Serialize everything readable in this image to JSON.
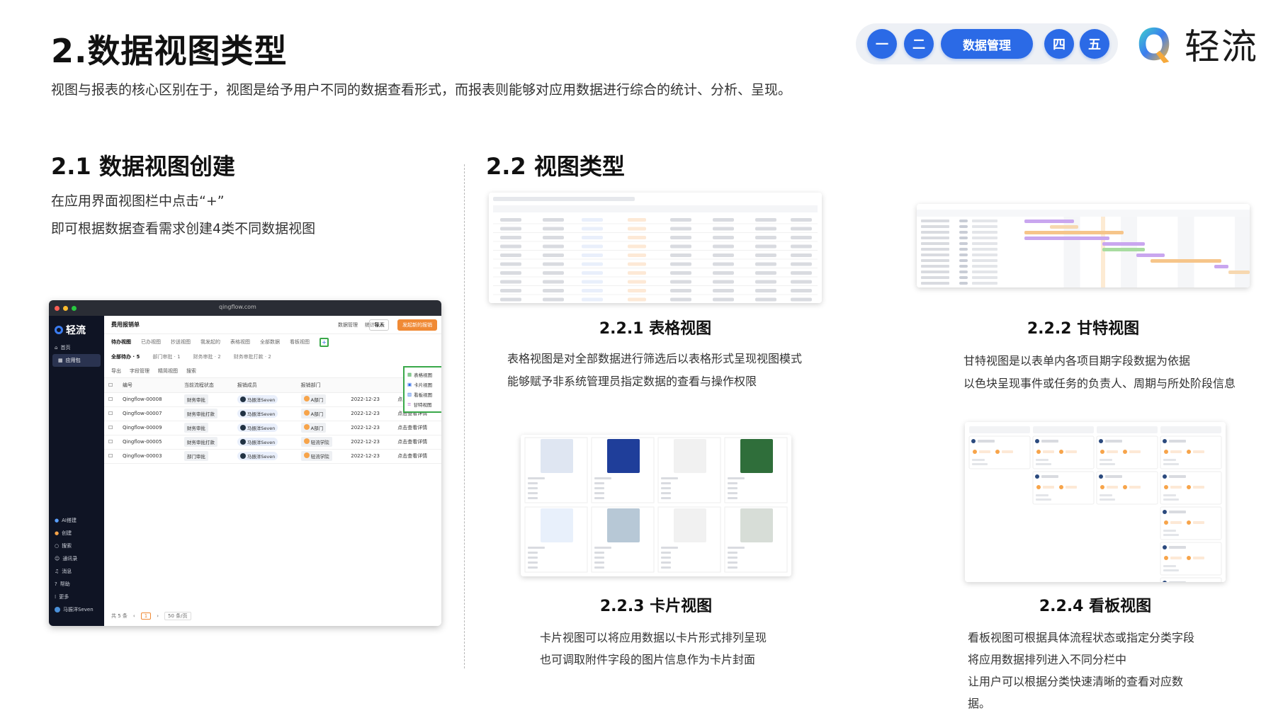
{
  "header": {
    "title": "2.数据视图类型",
    "subtitle": "视图与报表的核心区别在于，视图是给予用户不同的数据查看形式，而报表则能够对应用数据进行综合的统计、分析、呈现。"
  },
  "nav": {
    "items": [
      "一",
      "二",
      "数据管理",
      "四",
      "五"
    ],
    "active_index": 2
  },
  "brand": {
    "name": "轻流"
  },
  "section1": {
    "title": "2.1 数据视图创建",
    "line1": "在应用界面视图栏中点击“+”",
    "line2": "即可根据数据查看需求创建4类不同数据视图"
  },
  "section2": {
    "title": "2.2 视图类型"
  },
  "views": {
    "table": {
      "title": "2.2.1 表格视图",
      "line1": "表格视图是对全部数据进行筛选后以表格形式呈现视图模式",
      "line2": "能够赋予非系统管理员指定数据的查看与操作权限"
    },
    "gantt": {
      "title": "2.2.2 甘特视图",
      "line1": "甘特视图是以表单内各项目期字段数据为依据",
      "line2": "以色块呈现事件或任务的负责人、周期与所处阶段信息"
    },
    "card": {
      "title": "2.2.3 卡片视图",
      "line1": "卡片视图可以将应用数据以卡片形式排列呈现",
      "line2": "也可调取附件字段的图片信息作为卡片封面"
    },
    "kanban": {
      "title": "2.2.4 看板视图",
      "line1": "看板视图可根据具体流程状态或指定分类字段",
      "line2": "将应用数据排列进入不同分栏中",
      "line3": "让用户可以根据分类快速清晰的查看对应数",
      "line4": "据。"
    }
  },
  "mock_app": {
    "url": "qingflow.com",
    "logo": "轻流",
    "sidebar_top": [
      "首页",
      "应用包"
    ],
    "sidebar_bottom": [
      "AI搭建",
      "创建",
      "搜索",
      "通讯录",
      "消息",
      "帮助",
      "更多",
      "马振洋Seven"
    ],
    "app_title": "费用报销单",
    "tools": [
      "数据管理",
      "统计报表"
    ],
    "import_label": "导入",
    "primary_button": "发起新的报销",
    "tabs": [
      "待办视图",
      "已办视图",
      "抄送视图",
      "我发起的",
      "表格视图",
      "全部数据",
      "看板视图"
    ],
    "filters": [
      "全部待办 · 5",
      "部门审批 · 1",
      "财务审批 · 2",
      "财务审批打款 · 2"
    ],
    "actions": [
      "导出",
      "字段管理",
      "精简视图",
      "搜索"
    ],
    "columns": [
      "编号",
      "当前流程状态",
      "报销成员",
      "报销部门",
      "",
      ""
    ],
    "rows": [
      {
        "id": "Qingflow-00008",
        "status": "财务审批",
        "member": "马振洋Seven",
        "dept": "A部门",
        "date": "2022-12-23",
        "link": "点击查看详情"
      },
      {
        "id": "Qingflow-00007",
        "status": "财务审批打款",
        "member": "马振洋Seven",
        "dept": "A部门",
        "date": "2022-12-23",
        "link": "点击查看详情"
      },
      {
        "id": "Qingflow-00009",
        "status": "财务审批",
        "member": "马振洋Seven",
        "dept": "A部门",
        "date": "2022-12-23",
        "link": "点击查看详情"
      },
      {
        "id": "Qingflow-00005",
        "status": "财务审批打款",
        "member": "马振洋Seven",
        "dept": "轻流学院",
        "date": "2022-12-23",
        "link": "点击查看详情"
      },
      {
        "id": "Qingflow-00003",
        "status": "部门审批",
        "member": "马振洋Seven",
        "dept": "轻流学院",
        "date": "2022-12-23",
        "link": "点击查看详情"
      }
    ],
    "popup": [
      "表格视图",
      "卡片视图",
      "看板视图",
      "甘特视图"
    ],
    "pager": {
      "total": "共 5 条",
      "page": "1",
      "size": "50 条/页"
    }
  },
  "colors": {
    "accent": "#2b6ae6",
    "highlight": "#3aa84a",
    "orange": "#f08a35",
    "sidebar": "#0f1424"
  }
}
